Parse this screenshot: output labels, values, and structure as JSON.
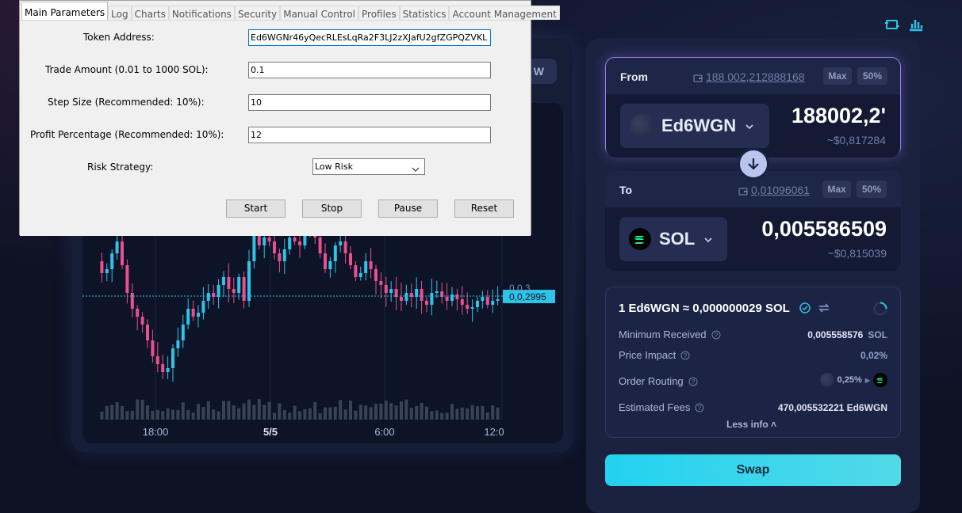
{
  "dialog": {
    "tabs": [
      "Main Parameters",
      "Log",
      "Charts",
      "Notifications",
      "Security",
      "Manual Control",
      "Profiles",
      "Statistics",
      "Account Management"
    ],
    "token_address_label": "Token Address:",
    "token_address_value": "Ed6WGNr46yQecRLEsLqRa2F3LJ2zXJafU2gfZGPQZVKL",
    "trade_amount_label": "Trade Amount (0.01 to 1000 SOL):",
    "trade_amount_value": "0.1",
    "step_size_label": "Step Size (Recommended: 10%):",
    "step_size_value": "10",
    "profit_label": "Profit Percentage (Recommended: 10%):",
    "profit_value": "12",
    "risk_label": "Risk Strategy:",
    "risk_value": "Low Risk",
    "buttons": {
      "start": "Start",
      "stop": "Stop",
      "pause": "Pause",
      "reset": "Reset"
    }
  },
  "chart": {
    "view_btn": "W",
    "x_ticks": [
      "18:00",
      "5/5",
      "6:00",
      "12:0"
    ],
    "price_label": "0,0,2995",
    "top_label": "0,0,3",
    "colors": {
      "up": "#2ec4e8",
      "down": "#ea4f8f",
      "price_line": "#2ec4e8"
    }
  },
  "swap": {
    "from": {
      "label": "From",
      "balance": "188 002,212888168",
      "max": "Max",
      "half": "50%",
      "token": "Ed6WGN",
      "amount": "188002,2'",
      "usd": "~$0,817284"
    },
    "to": {
      "label": "To",
      "balance": "0,01096061",
      "max": "Max",
      "half": "50%",
      "token": "SOL",
      "amount": "0,005586509",
      "usd": "~$0,815039"
    },
    "rate": "1 Ed6WGN ≈ 0,000000029 SOL",
    "rows": {
      "min_received_label": "Minimum Received",
      "min_received_value": "0,005558576",
      "min_received_unit": "SOL",
      "price_impact_label": "Price Impact",
      "price_impact_value": "0,02%",
      "order_routing_label": "Order Routing",
      "order_routing_value": "0,25%",
      "fees_label": "Estimated Fees",
      "fees_value": "470,005532221 Ed6WGN"
    },
    "less_info": "Less info",
    "swap_btn": "Swap"
  }
}
